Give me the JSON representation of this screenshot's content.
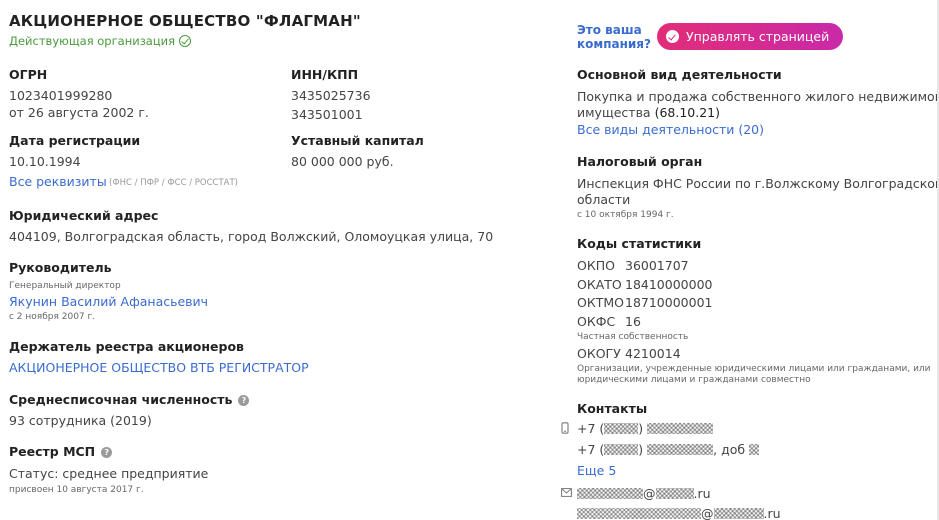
{
  "company": {
    "name": "АКЦИОНЕРНОЕ ОБЩЕСТВО \"ФЛАГМАН\"",
    "status": "Действующая организация"
  },
  "ogrn": {
    "label": "ОГРН",
    "value": "1023401999280",
    "date": "от 26 августа 2002 г."
  },
  "inn": {
    "label": "ИНН/КПП",
    "inn": "3435025736",
    "kpp": "343501001"
  },
  "registration": {
    "label": "Дата регистрации",
    "value": "10.10.1994"
  },
  "capital": {
    "label": "Уставный капитал",
    "value": "80 000 000 руб."
  },
  "requisites": {
    "link": "Все реквизиты",
    "note": "(ФНС / ПФР / ФСС / РОССТАТ)"
  },
  "address": {
    "label": "Юридический адрес",
    "value": "404109, Волгоградская область, город Волжский, Оломоуцкая улица, 70"
  },
  "head": {
    "label": "Руководитель",
    "role": "Генеральный директор",
    "name": "Якунин Василий Афанасьевич",
    "since": "с 2 ноября 2007 г."
  },
  "registrar": {
    "label": "Держатель реестра акционеров",
    "name": "АКЦИОНЕРНОЕ ОБЩЕСТВО ВТБ РЕГИСТРАТОР"
  },
  "employees": {
    "label": "Среднесписочная численность",
    "value": "93 сотрудника (2019)"
  },
  "msp": {
    "label": "Реестр МСП",
    "status": "Статус: среднее предприятие",
    "assigned": "присвоен 10 августа 2017 г."
  },
  "claim": {
    "text_line1": "Это ваша",
    "text_line2": "компания?",
    "button": "Управлять страницей"
  },
  "activity": {
    "label": "Основной вид деятельности",
    "line1": "Покупка и продажа собственного жилого недвижимого",
    "line2": "имущества",
    "code": "(68.10.21)",
    "link": "Все виды деятельности (20)"
  },
  "tax": {
    "label": "Налоговый орган",
    "line1": "Инспекция ФНС России по г.Волжскому Волгоградской",
    "line2": "области",
    "since": "с 10 октября 1994 г."
  },
  "stats": {
    "label": "Коды статистики",
    "okpo": {
      "key": "ОКПО",
      "value": "36001707"
    },
    "okato": {
      "key": "ОКАТО",
      "value": "18410000000"
    },
    "oktmo": {
      "key": "ОКТМО",
      "value": "18710000001"
    },
    "okfs": {
      "key": "ОКФС",
      "value": "16",
      "desc": "Частная собственность"
    },
    "okogu": {
      "key": "ОКОГУ",
      "value": "4210014",
      "desc1": "Организации, учрежденные юридическими лицами или гражданами, или",
      "desc2": "юридическими лицами и гражданами совместно"
    }
  },
  "contacts": {
    "label": "Контакты",
    "phone1_prefix": "+7 (",
    "phone2_prefix": "+7 (",
    "phone2_ext": ", доб",
    "more": "Еще 5",
    "email1_domain": "@",
    "email1_tld": ".ru",
    "email2_tld": ".ru"
  }
}
